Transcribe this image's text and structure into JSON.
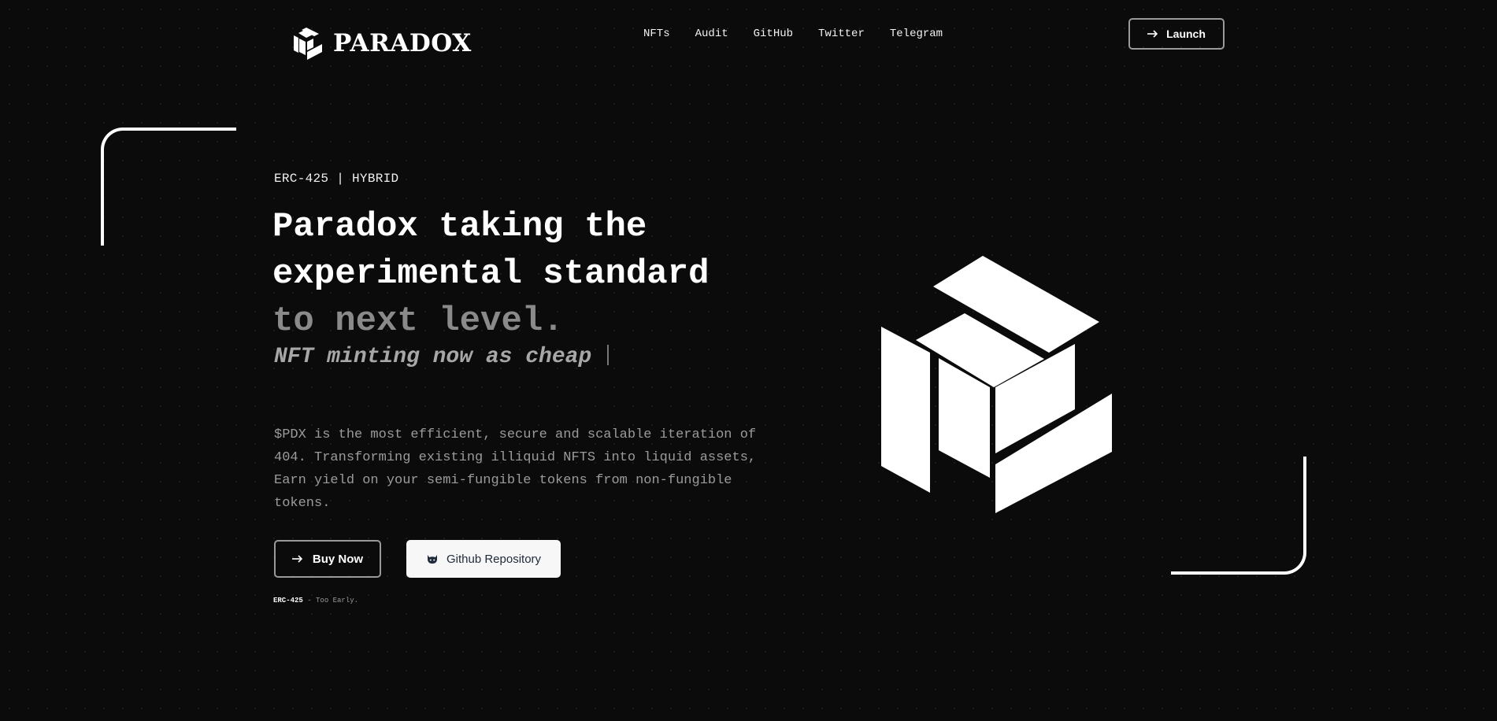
{
  "header": {
    "logo_text": "PARADOX",
    "nav": [
      "NFTs",
      "Audit",
      "GitHub",
      "Twitter",
      "Telegram"
    ],
    "launch_label": "Launch"
  },
  "hero": {
    "tagline": "ERC-425 | HYBRID",
    "headline_line1": "Paradox taking the",
    "headline_line2": "experimental standard",
    "headline_line3": "to next level.",
    "typing_text": "NFT minting now as cheap",
    "description": "$PDX is the most efficient, secure and scalable iteration of 404. Transforming existing illiquid NFTS into liquid assets, Earn yield on your semi-fungible tokens from non-fungible tokens.",
    "buy_label": "Buy Now",
    "github_label": "Github Repository",
    "footnote_strong": "ERC-425",
    "footnote_sep": " - ",
    "footnote_text": "Too Early."
  },
  "icons": {
    "logo": "cube-logo-icon",
    "arrow": "arrow-right-icon",
    "github": "github-icon",
    "hero_graphic": "cube-illustration"
  },
  "colors": {
    "background": "#0b0b0b",
    "foreground": "#ffffff",
    "muted_text": "#9b9b9b",
    "button_border": "#9a9a9a",
    "github_button_bg": "#f7f7f7"
  }
}
